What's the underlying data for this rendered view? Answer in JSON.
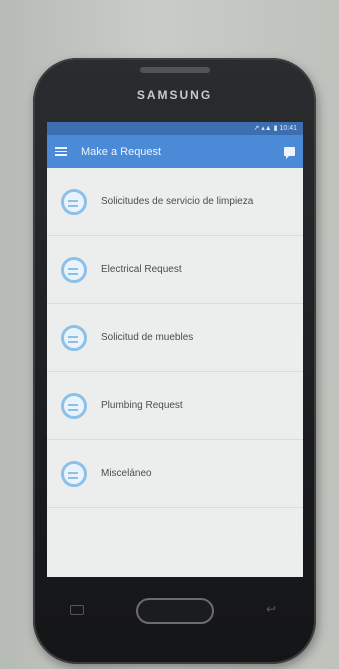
{
  "device": {
    "brand": "SAMSUNG"
  },
  "status_bar": {
    "text": "↗ ▴▲ ▮ 10:41"
  },
  "app_bar": {
    "title": "Make a Request",
    "menu_icon": "hamburger-menu-icon",
    "action_icon": "chat-icon"
  },
  "list": {
    "items": [
      {
        "label": "Solicitudes de servicio de limpieza",
        "icon": "chat-bubble-icon"
      },
      {
        "label": "Electrical Request",
        "icon": "chat-bubble-icon"
      },
      {
        "label": "Solicitud de muebles",
        "icon": "chat-bubble-icon"
      },
      {
        "label": "Plumbing Request",
        "icon": "chat-bubble-icon"
      },
      {
        "label": "Misceláneo",
        "icon": "chat-bubble-icon"
      }
    ]
  },
  "colors": {
    "app_bar": "#4a8ad6",
    "status_bar": "#3d6fb0",
    "icon_accent": "#8cc0e6",
    "screen_bg": "#eceeed"
  }
}
